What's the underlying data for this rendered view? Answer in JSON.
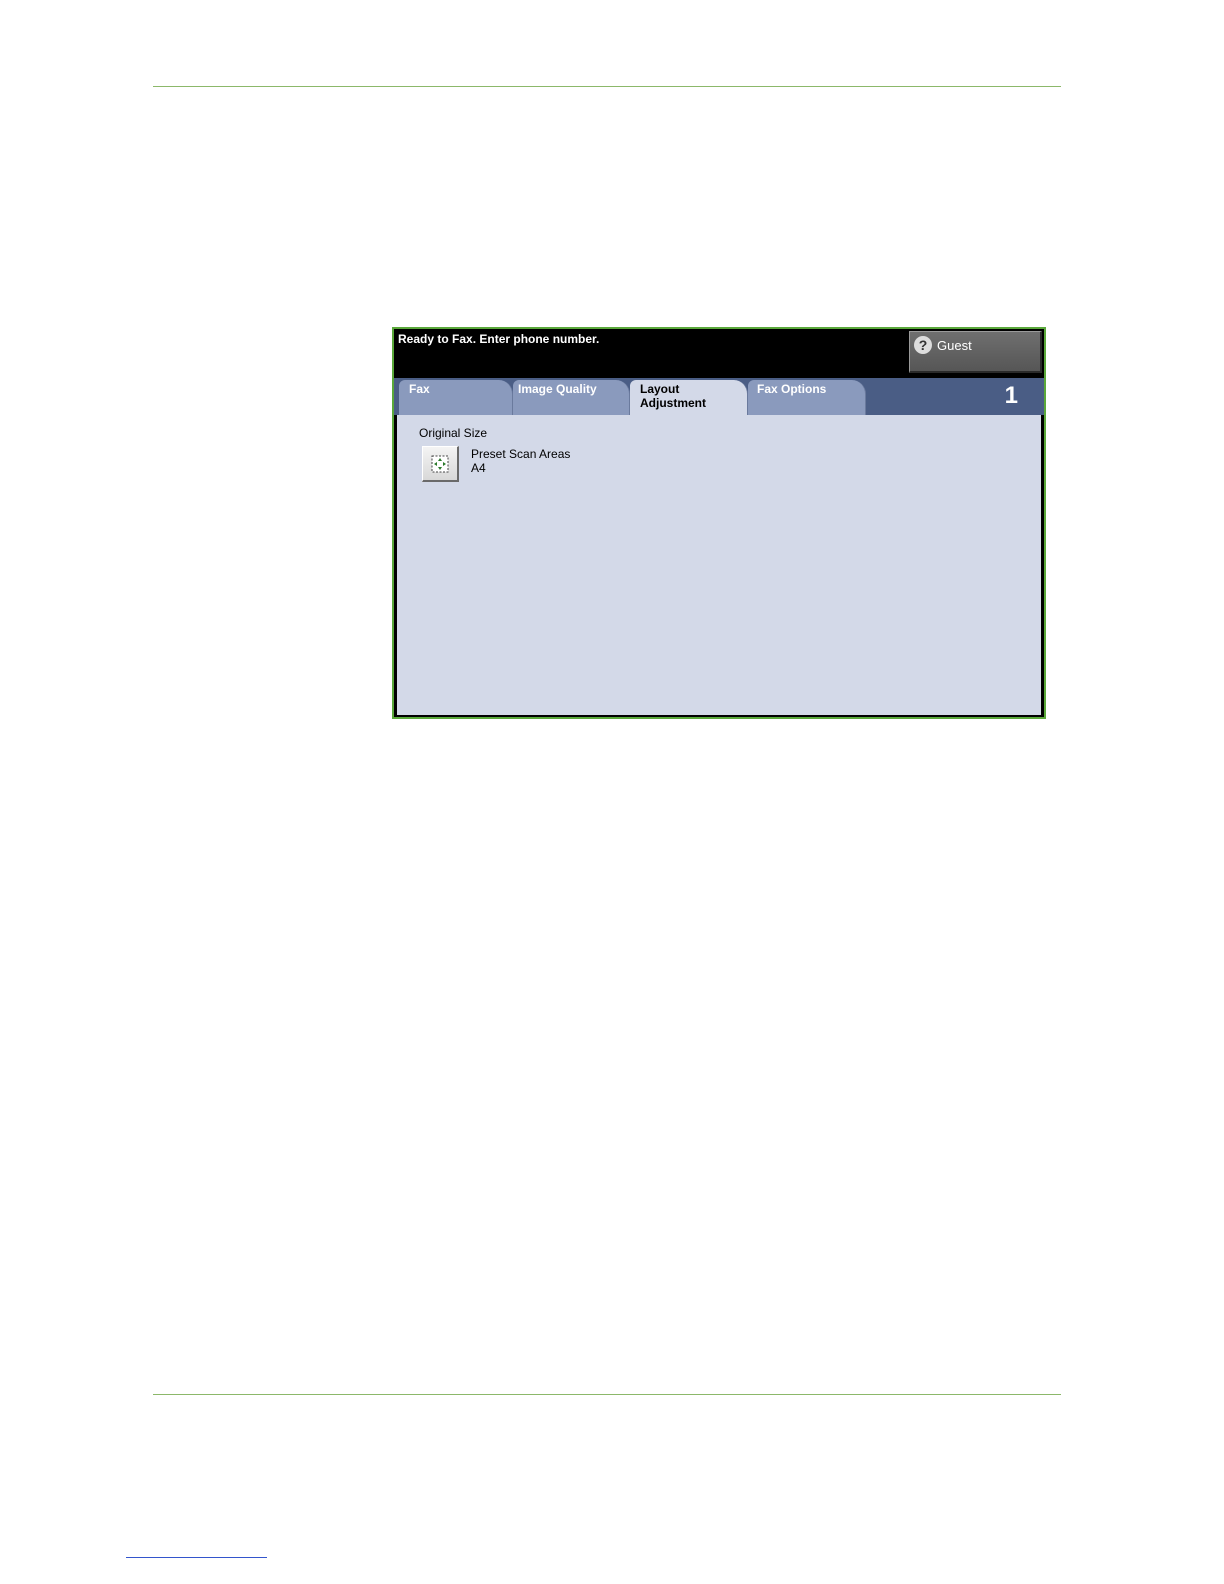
{
  "status": {
    "message": "Ready to Fax. Enter phone number."
  },
  "user": {
    "label": "Guest",
    "icon": "help-question-icon"
  },
  "tabs": [
    {
      "label": "Fax"
    },
    {
      "label": "Image Quality"
    },
    {
      "label_line1": "Layout",
      "label_line2": "Adjustment",
      "active": true
    },
    {
      "label": "Fax Options"
    }
  ],
  "page_indicator": "1",
  "original_size": {
    "title": "Original Size",
    "option_line1": "Preset Scan Areas",
    "option_line2": "A4",
    "icon": "original-size-icon"
  },
  "colors": {
    "screen_border": "#5aa83a",
    "tab_bar": "#4a5d85",
    "tab": "#8a9abd",
    "panel": "#d3d9e8",
    "rule": "#8cb86a"
  }
}
